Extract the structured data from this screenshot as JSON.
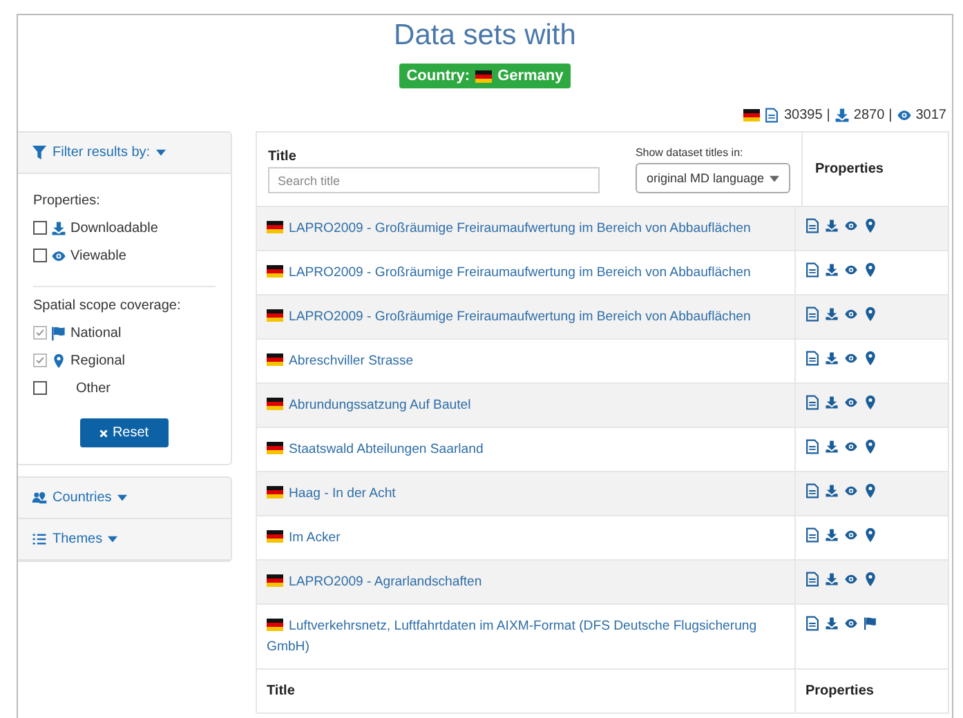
{
  "heading": "Data sets with",
  "country_badge": {
    "label": "Country:",
    "country": "Germany"
  },
  "stats": [
    {
      "kind": "metadata",
      "count": "30395"
    },
    {
      "kind": "download",
      "count": "2870"
    },
    {
      "kind": "view",
      "count": "3017"
    }
  ],
  "stats_separator": "|",
  "filter_panel": {
    "title": "Filter results by:",
    "groups": [
      {
        "label": "Properties:",
        "options": [
          {
            "kind": "download",
            "label": "Downloadable",
            "checked": false
          },
          {
            "kind": "view",
            "label": "Viewable",
            "checked": false
          }
        ]
      },
      {
        "label": "Spatial scope coverage:",
        "options": [
          {
            "kind": "national",
            "label": "National",
            "checked": true
          },
          {
            "kind": "regional",
            "label": "Regional",
            "checked": true
          },
          {
            "kind": "none",
            "label": "Other",
            "checked": false
          }
        ]
      }
    ],
    "reset_button": "Reset"
  },
  "side_menu": [
    {
      "kind": "countries",
      "label": "Countries"
    },
    {
      "kind": "themes",
      "label": "Themes"
    }
  ],
  "table": {
    "title_column": "Title",
    "search_placeholder": "Search title",
    "language_label": "Show dataset titles in:",
    "language_value": "original MD language",
    "properties_column": "Properties",
    "rows": [
      {
        "title": "LAPRO2009 - Großräumige Freiraumaufwertung im Bereich von Abbauflächen",
        "properties": [
          {
            "kind": "metadata"
          },
          {
            "kind": "download"
          },
          {
            "kind": "view"
          },
          {
            "kind": "regional"
          }
        ]
      },
      {
        "title": "LAPRO2009 - Großräumige Freiraumaufwertung im Bereich von Abbauflächen",
        "properties": [
          {
            "kind": "metadata"
          },
          {
            "kind": "download"
          },
          {
            "kind": "view"
          },
          {
            "kind": "regional"
          }
        ]
      },
      {
        "title": "LAPRO2009 - Großräumige Freiraumaufwertung im Bereich von Abbauflächen",
        "properties": [
          {
            "kind": "metadata"
          },
          {
            "kind": "download"
          },
          {
            "kind": "view"
          },
          {
            "kind": "regional"
          }
        ]
      },
      {
        "title": "Abreschviller Strasse",
        "properties": [
          {
            "kind": "metadata"
          },
          {
            "kind": "download"
          },
          {
            "kind": "view"
          },
          {
            "kind": "regional"
          }
        ]
      },
      {
        "title": "Abrundungssatzung Auf Bautel",
        "properties": [
          {
            "kind": "metadata"
          },
          {
            "kind": "download"
          },
          {
            "kind": "view"
          },
          {
            "kind": "regional"
          }
        ]
      },
      {
        "title": "Staatswald Abteilungen Saarland",
        "properties": [
          {
            "kind": "metadata"
          },
          {
            "kind": "download"
          },
          {
            "kind": "view"
          },
          {
            "kind": "regional"
          }
        ]
      },
      {
        "title": "Haag - In der Acht",
        "properties": [
          {
            "kind": "metadata"
          },
          {
            "kind": "download"
          },
          {
            "kind": "view"
          },
          {
            "kind": "regional"
          }
        ]
      },
      {
        "title": "Im Acker",
        "properties": [
          {
            "kind": "metadata"
          },
          {
            "kind": "download"
          },
          {
            "kind": "view"
          },
          {
            "kind": "regional"
          }
        ]
      },
      {
        "title": "LAPRO2009 - Agrarlandschaften",
        "properties": [
          {
            "kind": "metadata"
          },
          {
            "kind": "download"
          },
          {
            "kind": "view"
          },
          {
            "kind": "regional"
          }
        ]
      },
      {
        "title": "Luftverkehrsnetz, Luftfahrtdaten im AIXM-Format (DFS Deutsche Flugsicherung GmbH)",
        "properties": [
          {
            "kind": "metadata"
          },
          {
            "kind": "download"
          },
          {
            "kind": "view"
          },
          {
            "kind": "national"
          }
        ]
      }
    ],
    "footer_title_column": "Title",
    "footer_properties_column": "Properties"
  }
}
